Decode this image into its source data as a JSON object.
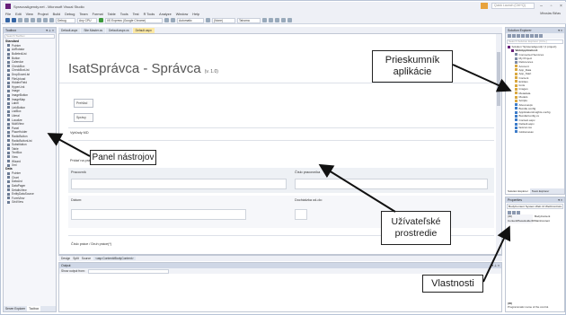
{
  "window": {
    "title": "SpravcaAgendy.net - Microsoft Visual Studio",
    "quick_launch_placeholder": "Quick Launch (Ctrl+Q)",
    "signin": "Miroslav Biňas"
  },
  "menu": [
    "File",
    "Edit",
    "View",
    "Project",
    "Build",
    "Debug",
    "Team",
    "Format",
    "Table",
    "Tools",
    "Test",
    "R Tools",
    "Analyze",
    "Window",
    "Help"
  ],
  "toolbar": {
    "config": "Debug",
    "platform": "Any CPU",
    "run_target": "IIS Express (Google Chrome)",
    "zoom": "Automatic",
    "style": "(None)",
    "font": "Tahoma"
  },
  "toolbox": {
    "title": "Toolbox",
    "search_placeholder": "Search Toolbox",
    "groups": [
      {
        "name": "Standard",
        "items": [
          "Pointer",
          "AdRotator",
          "BulletedList",
          "Button",
          "Calendar",
          "CheckBox",
          "CheckBoxList",
          "DropDownList",
          "FileUpload",
          "HiddenField",
          "HyperLink",
          "Image",
          "ImageButton",
          "ImageMap",
          "Label",
          "LinkButton",
          "ListBox",
          "Literal",
          "Localize",
          "MultiView",
          "Panel",
          "PlaceHolder",
          "RadioButton",
          "RadioButtonList",
          "Substitution",
          "Table",
          "TextBox",
          "View",
          "Wizard",
          "Xml"
        ]
      },
      {
        "name": "Data",
        "items": [
          "Pointer",
          "Chart",
          "DataList",
          "DataPager",
          "DetailsView",
          "EntityDataSource",
          "FormView",
          "GridView"
        ]
      }
    ],
    "tabs": [
      "Server Explorer",
      "Toolbox"
    ]
  },
  "doc_tabs": [
    "Default.aspx",
    "Site.Master.cs",
    "Default.aspx.cs",
    "Default.aspx"
  ],
  "page": {
    "title": "IsatSprávca - Správca",
    "title_suffix": "(v. 1.0)",
    "nav_buttons": [
      "Prehľad",
      "Správy"
    ],
    "section": "Vyhľady MD",
    "hint": "Pridať na prácu a výber práce",
    "field_worker": "Pracovník",
    "field_worker_no": "Číslo pracovníka",
    "field_date": "Dátum:",
    "field_attendance": "Dochádzka od-do:",
    "footer_label": "Číslo práce / Druh práce(*)"
  },
  "design_bar": {
    "design": "Design",
    "split": "Split",
    "source": "Source",
    "crumbs": [
      "<asp:Content#BodyContent>"
    ]
  },
  "output": {
    "title": "Output",
    "show_from": "Show output from:"
  },
  "solution_explorer": {
    "title": "Solution Explorer",
    "search_placeholder": "Search Solution Explorer (Ctrl+;)",
    "items": [
      {
        "label": "Solution 'SpravcaAgendy' (1 project)",
        "kind": "sln",
        "indent": 0
      },
      {
        "label": "WebApplication1",
        "kind": "proj",
        "indent": 1
      },
      {
        "label": "Connected Services",
        "kind": "ref",
        "indent": 2
      },
      {
        "label": "My Project",
        "kind": "ref",
        "indent": 2
      },
      {
        "label": "References",
        "kind": "ref",
        "indent": 2
      },
      {
        "label": "Account",
        "kind": "folder",
        "indent": 2
      },
      {
        "label": "App_Data",
        "kind": "folder",
        "indent": 2
      },
      {
        "label": "App_Start",
        "kind": "folder",
        "indent": 2
      },
      {
        "label": "Content",
        "kind": "folder",
        "indent": 2
      },
      {
        "label": "Entities",
        "kind": "folder",
        "indent": 2
      },
      {
        "label": "fonts",
        "kind": "folder",
        "indent": 2
      },
      {
        "label": "Images",
        "kind": "folder",
        "indent": 2
      },
      {
        "label": "Metadata",
        "kind": "folder",
        "indent": 2
      },
      {
        "label": "Models",
        "kind": "folder",
        "indent": 2
      },
      {
        "label": "Scripts",
        "kind": "folder",
        "indent": 2
      },
      {
        "label": "About.aspx",
        "kind": "file",
        "indent": 2
      },
      {
        "label": "Bundle.config",
        "kind": "file",
        "indent": 2
      },
      {
        "label": "ApplicationInsights.config",
        "kind": "file",
        "indent": 2
      },
      {
        "label": "BundleConfig.cs",
        "kind": "file",
        "indent": 2
      },
      {
        "label": "Contact.aspx",
        "kind": "file",
        "indent": 2
      },
      {
        "label": "Default.aspx",
        "kind": "file",
        "indent": 2
      },
      {
        "label": "favicon.ico",
        "kind": "file",
        "indent": 2
      },
      {
        "label": "Global.asax",
        "kind": "file",
        "indent": 2
      }
    ],
    "tabs": [
      "Solution Explorer",
      "Team Explorer"
    ]
  },
  "properties": {
    "title": "Properties",
    "object": "BodyContent System.Web.UI.WebControls.Content",
    "rows": [
      {
        "k": "(ID)",
        "v": "BodyContent"
      },
      {
        "k": "ContentPlaceHolderID",
        "v": "MainContent"
      }
    ],
    "description_title": "(ID)",
    "description": "Programmatic name of the control."
  },
  "callouts": {
    "solution": "Prieskumník aplikácie",
    "toolbox": "Panel nástrojov",
    "design": "Užívateľské prostredie",
    "properties": "Vlastnosti"
  }
}
